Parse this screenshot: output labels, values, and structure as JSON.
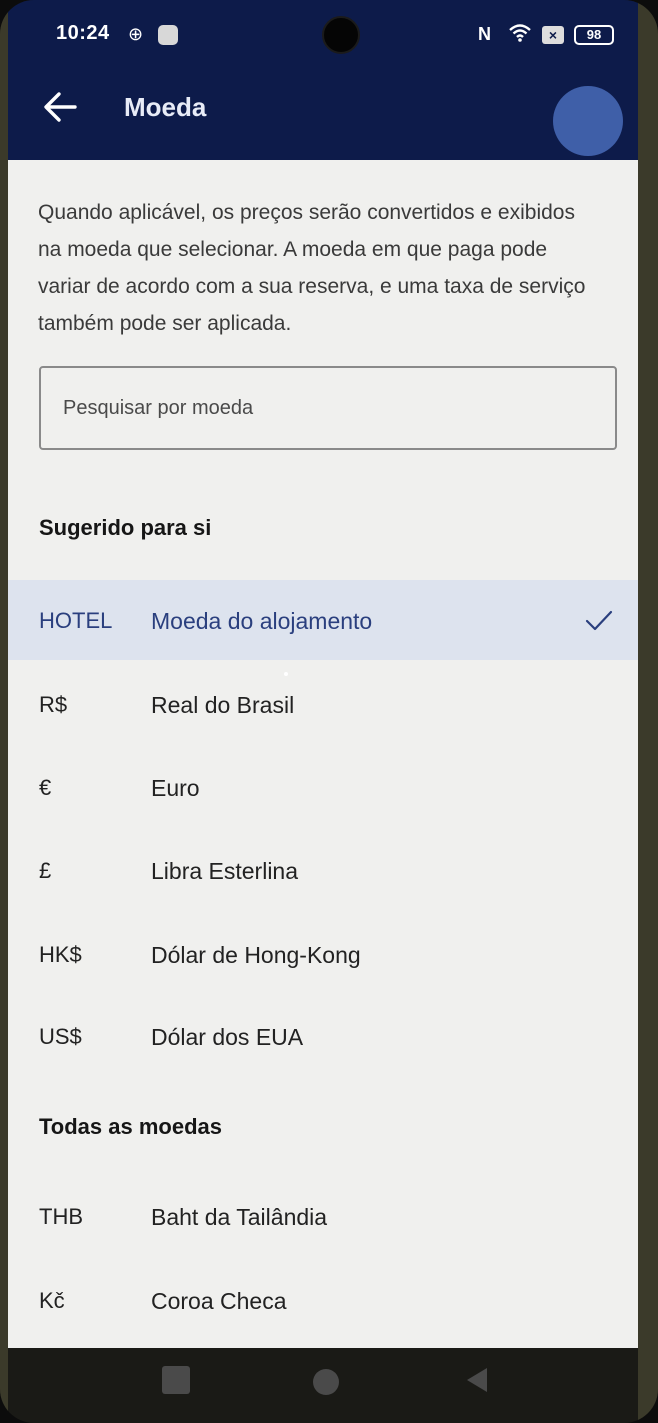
{
  "status_bar": {
    "time": "10:24",
    "battery": "98"
  },
  "header": {
    "title": "Moeda",
    "back_icon": "arrow-left-icon",
    "avatar_icon": "avatar-circle"
  },
  "intro_text": "Quando aplicável, os preços serão convertidos e exibidos na moeda que selecionar. A moeda em que paga pode variar de acordo com a sua reserva, e uma taxa de serviço também pode ser aplicada.",
  "search": {
    "placeholder": "Pesquisar por moeda"
  },
  "suggested": {
    "heading": "Sugerido para si",
    "items": [
      {
        "code": "HOTEL",
        "name": "Moeda do alojamento",
        "selected": true
      },
      {
        "code": "R$",
        "name": "Real do Brasil"
      },
      {
        "code": "€",
        "name": "Euro"
      },
      {
        "code": "£",
        "name": "Libra Esterlina"
      },
      {
        "code": "HK$",
        "name": "Dólar de Hong-Kong"
      },
      {
        "code": "US$",
        "name": "Dólar dos EUA"
      }
    ]
  },
  "all": {
    "heading": "Todas as moedas",
    "items": [
      {
        "code": "THB",
        "name": "Baht da Tailândia"
      },
      {
        "code": "Kč",
        "name": "Coroa Checa"
      }
    ]
  },
  "colors": {
    "header_bg": "#0d1b4a",
    "accent": "#2a3f7e",
    "selected_bg": "#dde3ee"
  }
}
